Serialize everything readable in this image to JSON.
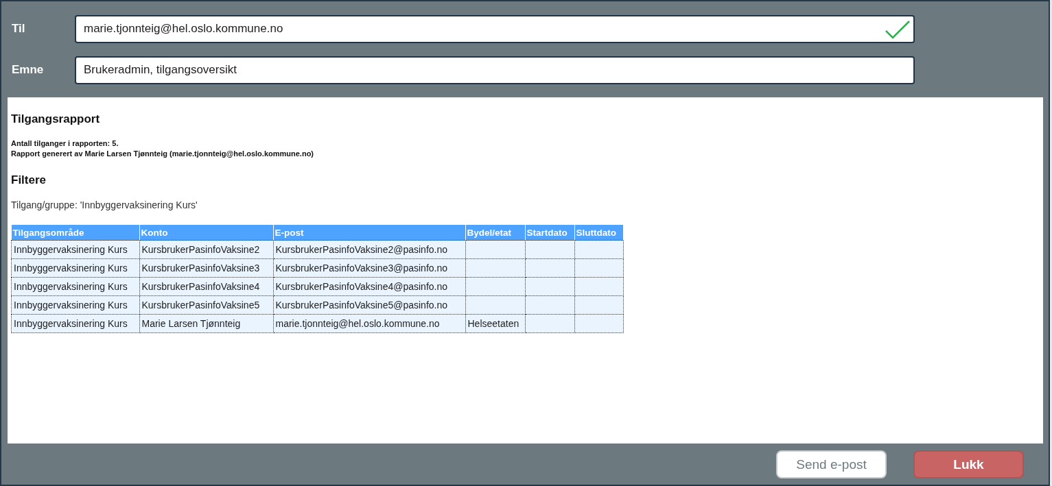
{
  "fields": [
    {
      "label": "Til",
      "value": "marie.tjonnteig@hel.oslo.kommune.no",
      "valid": true
    },
    {
      "label": "Emne",
      "value": "Brukeradmin, tilgangsoversikt",
      "valid": false
    }
  ],
  "report": {
    "title": "Tilgangsrapport",
    "summary_lines": [
      "Antall tilganger i rapporten: 5.",
      "Rapport generert av Marie Larsen Tjønnteig (marie.tjonnteig@hel.oslo.kommune.no)"
    ],
    "filter_heading": "Filtere",
    "filter_text": "Tilgang/gruppe: 'Innbyggervaksinering Kurs'",
    "table": {
      "columns": [
        "Tilgangsområde",
        "Konto",
        "E-post",
        "Bydel/etat",
        "Startdato",
        "Sluttdato"
      ],
      "rows": [
        [
          "Innbyggervaksinering Kurs",
          "KursbrukerPasinfoVaksine2",
          "KursbrukerPasinfoVaksine2@pasinfo.no",
          "",
          "",
          ""
        ],
        [
          "Innbyggervaksinering Kurs",
          "KursbrukerPasinfoVaksine3",
          "KursbrukerPasinfoVaksine3@pasinfo.no",
          "",
          "",
          ""
        ],
        [
          "Innbyggervaksinering Kurs",
          "KursbrukerPasinfoVaksine4",
          "KursbrukerPasinfoVaksine4@pasinfo.no",
          "",
          "",
          ""
        ],
        [
          "Innbyggervaksinering Kurs",
          "KursbrukerPasinfoVaksine5",
          "KursbrukerPasinfoVaksine5@pasinfo.no",
          "",
          "",
          ""
        ],
        [
          "Innbyggervaksinering Kurs",
          "Marie Larsen Tjønnteig",
          "marie.tjonnteig@hel.oslo.kommune.no",
          "Helseetaten",
          "",
          ""
        ]
      ]
    }
  },
  "buttons": [
    {
      "label": "Send e-post",
      "kind": "secondary"
    },
    {
      "label": "Lukk",
      "kind": "danger"
    }
  ]
}
